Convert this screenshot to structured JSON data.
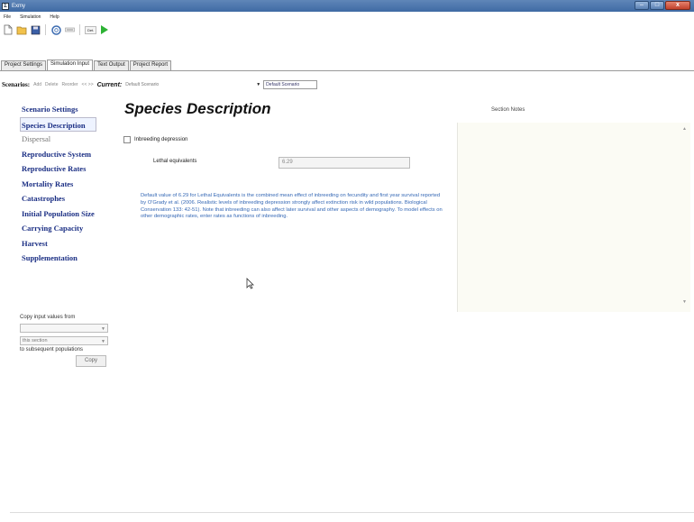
{
  "window": {
    "title": "Exmy",
    "icon_letter": "Σ",
    "min": "–",
    "max": "□",
    "close": "x"
  },
  "menu": [
    "File",
    "Simulation",
    "Help"
  ],
  "toolbar": {
    "text_button": "Det."
  },
  "tabs": [
    "Project Settings",
    "Simulation Input",
    "Text Output",
    "Project Report"
  ],
  "scenario_bar": {
    "label": "Scenarios:",
    "add": "Add",
    "delete": "Delete",
    "reorder": "Reorder",
    "nav": "<<  >>",
    "current_label": "Current:",
    "current_value": "Default Scenario",
    "select_value": "Default Scenario"
  },
  "sections": [
    "Scenario Settings",
    "Species Description",
    "Dispersal",
    "Reproductive System",
    "Reproductive Rates",
    "Mortality Rates",
    "Catastrophes",
    "Initial Population Size",
    "Carrying Capacity",
    "Harvest",
    "Supplementation"
  ],
  "copy_panel": {
    "label_top": "Copy input values from",
    "combo1_value": "",
    "combo2_value": "this section",
    "label_bottom": "to subsequent populations",
    "button": "Copy"
  },
  "main": {
    "heading": "Species Description",
    "checkbox_label": "Inbreeding depression",
    "lethal_label": "Lethal equivalents",
    "lethal_value": "6.29",
    "note": "Default value of 6.29 for Lethal Equivalents is the combined mean effect of inbreeding on fecundity and first year survival reported by O'Grady et al. (2006. Realistic levels of inbreeding depression strongly affect extinction risk in wild populations. Biological Conservation 133: 42-51). Note that inbreeding can also affect later survival and other aspects of demography. To model effects on other demographic rates, enter rates as functions of inbreeding."
  },
  "notes": {
    "title": "Section Notes",
    "scroll_up": "▲",
    "scroll_down": "▼"
  }
}
